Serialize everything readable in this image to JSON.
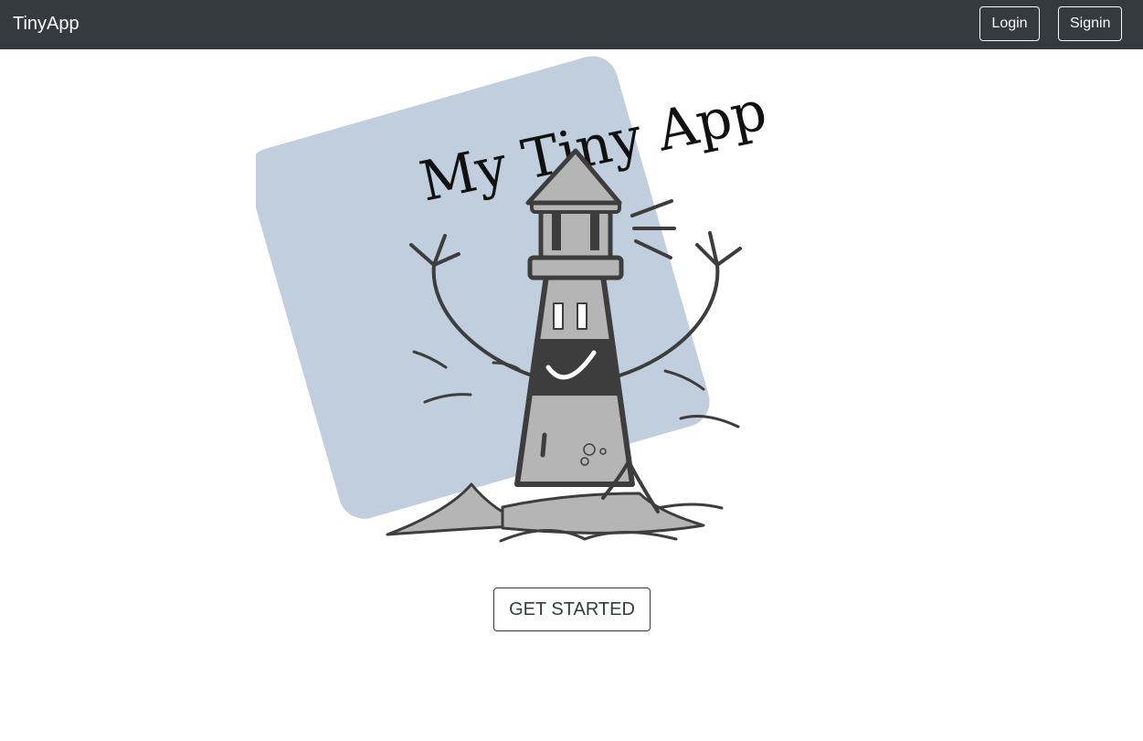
{
  "navbar": {
    "brand": "TinyApp",
    "login_label": "Login",
    "signin_label": "Signin",
    "background_color": "#343a40"
  },
  "hero": {
    "logo_text": "My Tiny App",
    "logo_square_color": "#c1cedd",
    "illustration": "lighthouse-illustration"
  },
  "cta": {
    "label": "GET STARTED"
  }
}
